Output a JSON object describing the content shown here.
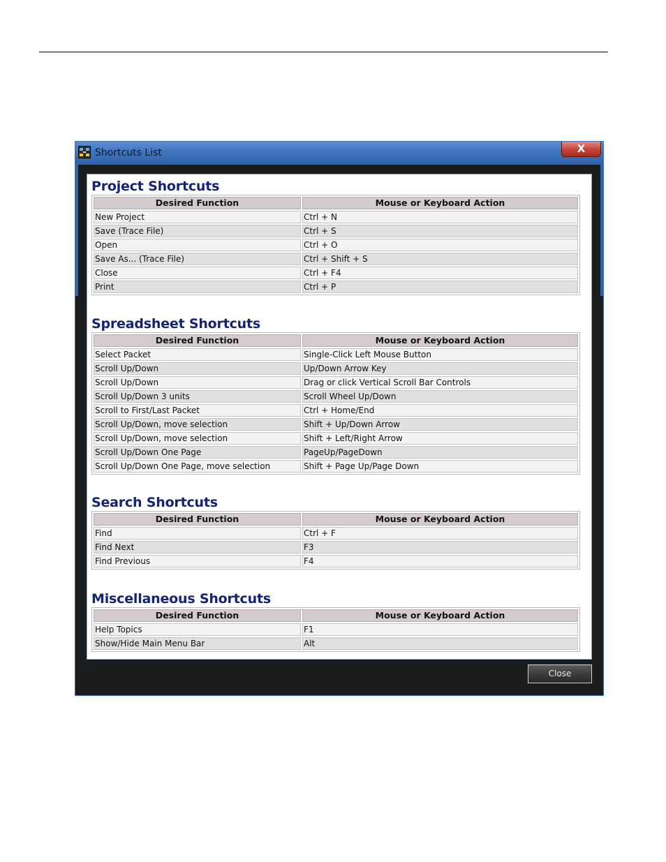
{
  "window": {
    "title": "Shortcuts List",
    "close_glyph": "X",
    "close_button": "Close"
  },
  "icons": {
    "app": "app-icon",
    "close": "close-icon"
  },
  "colors": {
    "section_title": "#13237a",
    "titlebar": "#3f74bd",
    "header_cell": "#d4cccc"
  },
  "headers": {
    "function": "Desired Function",
    "action": "Mouse or Keyboard Action"
  },
  "sections": [
    {
      "title": "Project Shortcuts",
      "rows": [
        [
          "New Project",
          "Ctrl + N"
        ],
        [
          "Save (Trace File)",
          "Ctrl + S"
        ],
        [
          "Open",
          "Ctrl + O"
        ],
        [
          "Save As... (Trace File)",
          "Ctrl + Shift + S"
        ],
        [
          "Close",
          "Ctrl + F4"
        ],
        [
          "Print",
          "Ctrl + P"
        ]
      ]
    },
    {
      "title": "Spreadsheet Shortcuts",
      "rows": [
        [
          "Select Packet",
          "Single-Click Left Mouse Button"
        ],
        [
          "Scroll Up/Down",
          "Up/Down Arrow Key"
        ],
        [
          "Scroll Up/Down",
          "Drag or click Vertical Scroll Bar Controls"
        ],
        [
          "Scroll Up/Down 3 units",
          "Scroll Wheel Up/Down"
        ],
        [
          "Scroll to First/Last Packet",
          "Ctrl + Home/End"
        ],
        [
          "Scroll Up/Down, move selection",
          "Shift + Up/Down Arrow"
        ],
        [
          "Scroll Up/Down, move selection",
          "Shift + Left/Right Arrow"
        ],
        [
          "Scroll Up/Down One Page",
          "PageUp/PageDown"
        ],
        [
          "Scroll Up/Down One Page, move selection",
          "Shift + Page Up/Page Down"
        ]
      ]
    },
    {
      "title": "Search Shortcuts",
      "rows": [
        [
          "Find",
          "Ctrl + F"
        ],
        [
          "Find Next",
          "F3"
        ],
        [
          "Find Previous",
          "F4"
        ]
      ]
    },
    {
      "title": "Miscellaneous Shortcuts",
      "rows": [
        [
          "Help Topics",
          "F1"
        ],
        [
          "Show/Hide Main Menu Bar",
          "Alt"
        ]
      ]
    }
  ]
}
